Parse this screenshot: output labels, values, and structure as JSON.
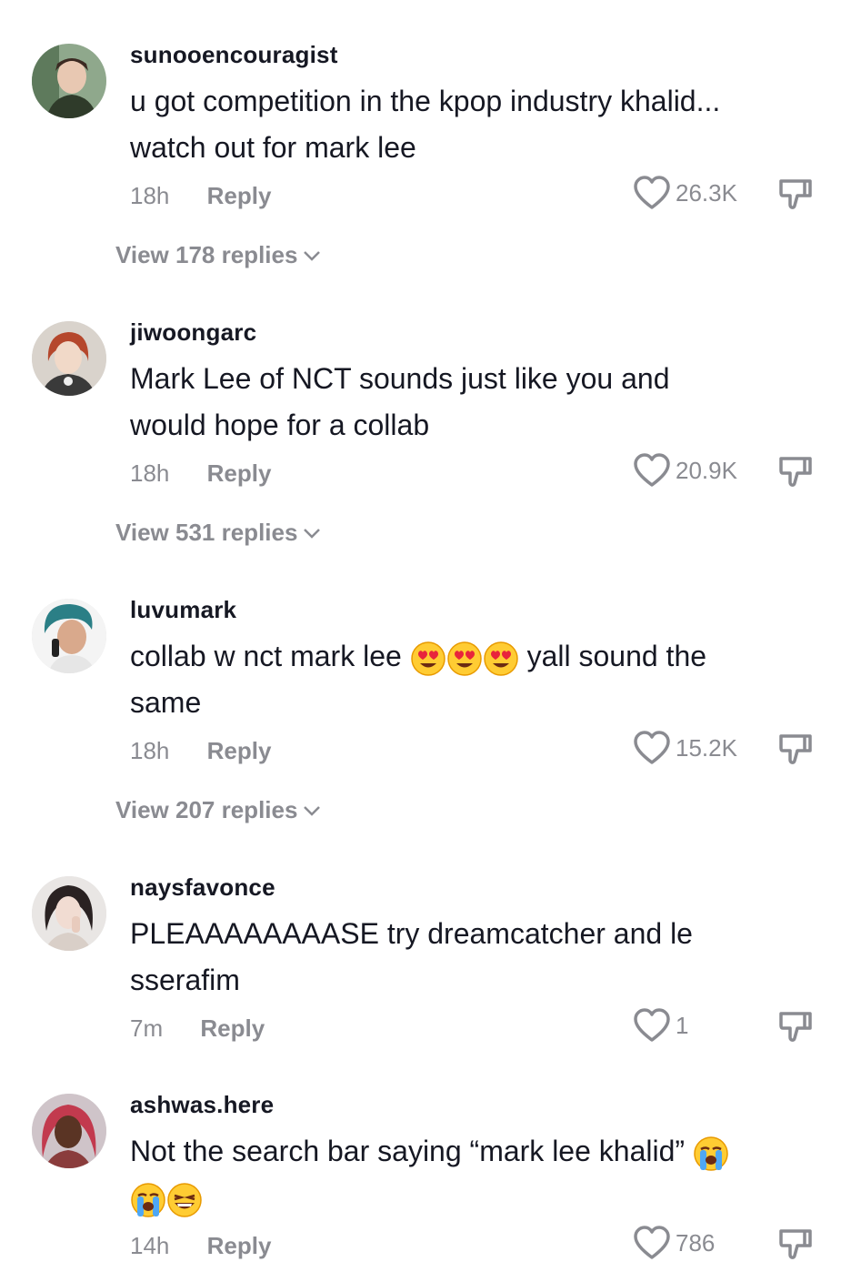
{
  "comments": [
    {
      "username": "sunooencouragist",
      "text": "u got competition in the kpop industry khalid... watch out for mark lee",
      "time": "18h",
      "reply_label": "Reply",
      "likes": "26.3K",
      "view_replies": "View 178 replies",
      "avatar_icon": "avatar-person-green-background"
    },
    {
      "username": "jiwoongarc",
      "text_before": "Mark Lee of NCT sounds just like you and would hope for a collab",
      "time": "18h",
      "reply_label": "Reply",
      "likes": "20.9K",
      "view_replies": "View 531 replies",
      "avatar_icon": "avatar-person-red-hair"
    },
    {
      "username": "luvumark",
      "text_before": "collab w nct mark lee",
      "text_after": "yall sound the same",
      "emojis": [
        "heart-eyes-emoji",
        "heart-eyes-emoji",
        "heart-eyes-emoji"
      ],
      "time": "18h",
      "reply_label": "Reply",
      "likes": "15.2K",
      "view_replies": "View 207 replies",
      "avatar_icon": "avatar-person-teal-hair"
    },
    {
      "username": "naysfavonce",
      "text": "PLEAAAAAAAASE try dreamcatcher and le sserafim",
      "time": "7m",
      "reply_label": "Reply",
      "likes": "1",
      "avatar_icon": "avatar-person-dark-hair"
    },
    {
      "username": "ashwas.here",
      "text": "Not the search bar saying “mark lee khalid”",
      "emojis": [
        "loudly-crying-emoji",
        "loudly-crying-emoji",
        "laughing-emoji"
      ],
      "time": "14h",
      "reply_label": "Reply",
      "likes": "786",
      "avatar_icon": "avatar-person-pink-hair"
    }
  ],
  "colors": {
    "text": "#161823",
    "meta": "#8a8b91",
    "background": "#ffffff"
  }
}
